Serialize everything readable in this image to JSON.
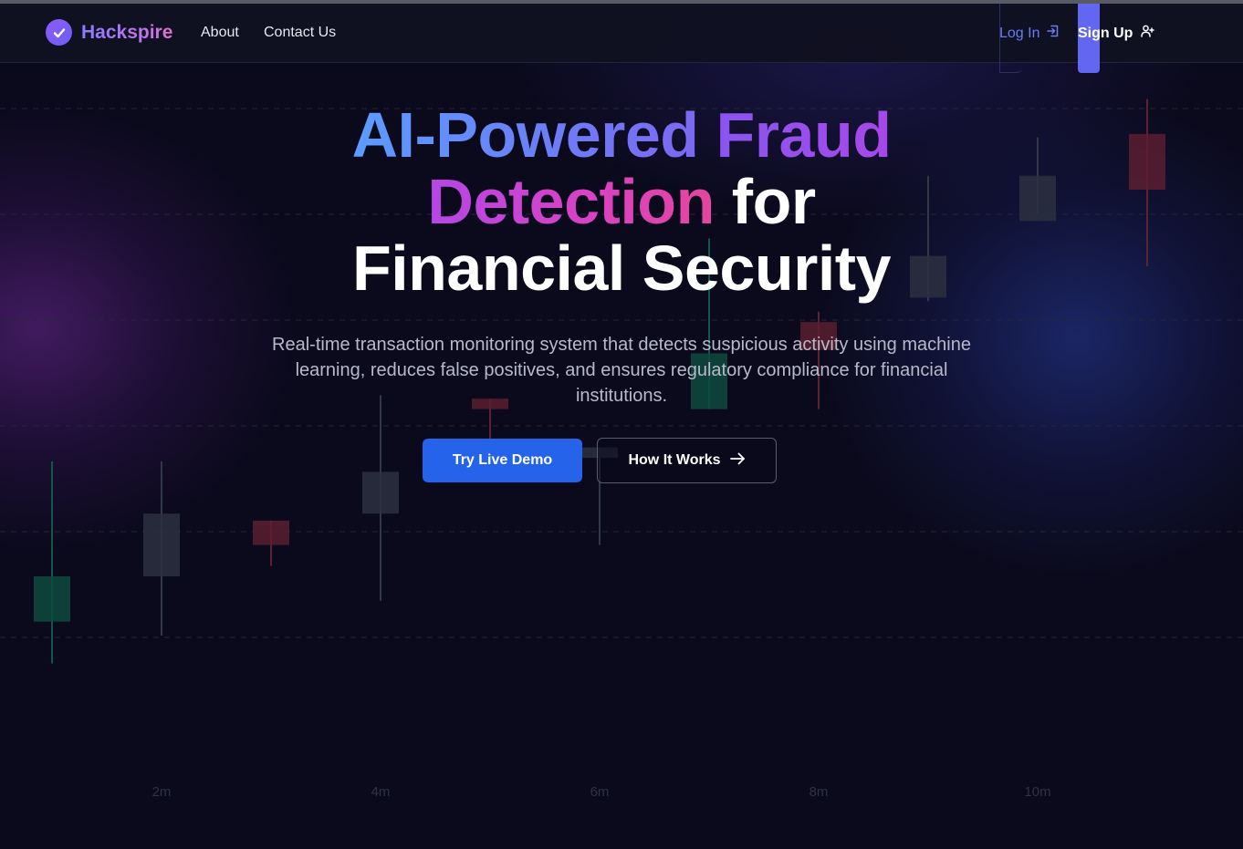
{
  "colors": {
    "background": "#0b0a1c",
    "accent": "#2563eb",
    "signup_accent": "#6366f1",
    "candle_up": "#0e4a3e",
    "candle_down": "#5a1e30",
    "candle_neutral": "#2c3040"
  },
  "navbar": {
    "brand": {
      "name": "Hackspire",
      "icon": "check-circle-icon"
    },
    "links": [
      {
        "label": "About"
      },
      {
        "label": "Contact Us"
      }
    ],
    "login": {
      "label": "Log In",
      "icon": "log-in-icon"
    },
    "signup": {
      "label": "Sign Up",
      "icon": "user-plus-icon"
    }
  },
  "hero": {
    "title": {
      "line1_part1": "AI-Powered",
      "line1_part2": "Fraud",
      "line2_part1": "Detection",
      "line2_part2": "for",
      "line3": "Financial Security"
    },
    "subtitle": "Real-time transaction monitoring system that detects suspicious activity using machine learning, reduces false positives, and ensures regulatory compliance for financial institutions.",
    "buttons": {
      "primary": "Try Live Demo",
      "secondary": "How It Works",
      "secondary_icon": "arrow-right-icon"
    }
  },
  "chart_data": {
    "type": "candlestick",
    "x_ticks": [
      "2m",
      "4m",
      "6m",
      "8m",
      "10m"
    ],
    "candles": [
      {
        "x": 1.0,
        "high": 3.3,
        "low": -2.5,
        "open": -1.3,
        "close": 0.0,
        "color": "up"
      },
      {
        "x": 2.0,
        "high": 3.3,
        "low": -1.7,
        "open": 1.8,
        "close": 0.0,
        "color": "neutral"
      },
      {
        "x": 3.0,
        "high": 1.6,
        "low": 0.3,
        "open": 1.6,
        "close": 0.9,
        "color": "down"
      },
      {
        "x": 4.0,
        "high": 5.2,
        "low": -0.7,
        "open": 3.0,
        "close": 1.8,
        "color": "neutral"
      },
      {
        "x": 5.0,
        "high": 5.1,
        "low": 2.8,
        "open": 5.1,
        "close": 4.8,
        "color": "down"
      },
      {
        "x": 6.0,
        "high": 3.7,
        "low": 0.9,
        "open": 3.7,
        "close": 3.4,
        "color": "neutral"
      },
      {
        "x": 7.0,
        "high": 9.7,
        "low": 4.8,
        "open": 4.8,
        "close": 6.4,
        "color": "up"
      },
      {
        "x": 8.0,
        "high": 7.6,
        "low": 4.8,
        "open": 6.5,
        "close": 7.3,
        "color": "down"
      },
      {
        "x": 9.0,
        "high": 11.5,
        "low": 7.9,
        "open": 9.2,
        "close": 8.0,
        "color": "neutral"
      },
      {
        "x": 10.0,
        "high": 12.6,
        "low": 10.4,
        "open": 11.5,
        "close": 10.2,
        "color": "neutral"
      },
      {
        "x": 11.0,
        "high": 13.7,
        "low": 8.9,
        "open": 12.7,
        "close": 11.1,
        "color": "down"
      }
    ]
  }
}
